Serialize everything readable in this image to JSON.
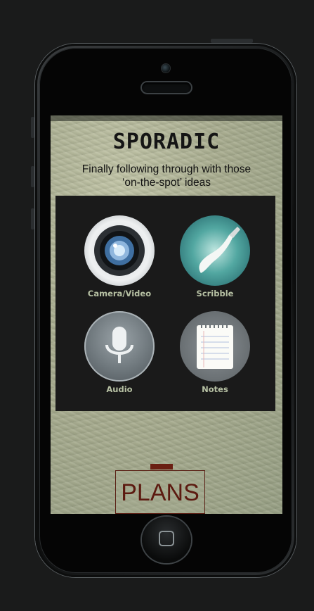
{
  "app": {
    "title": "SPORADIC",
    "tagline_line1": "Finally following through with those",
    "tagline_line2": "‘on-the-spot’ ideas"
  },
  "menu": {
    "items": [
      {
        "label": "Camera/Video",
        "icon": "camera-icon"
      },
      {
        "label": "Scribble",
        "icon": "brush-icon"
      },
      {
        "label": "Audio",
        "icon": "microphone-icon"
      },
      {
        "label": "Notes",
        "icon": "notepad-icon"
      }
    ]
  },
  "footer": {
    "plans_label": "PLANS"
  },
  "colors": {
    "background": "#1a1b1b",
    "panel": "#1a1a1a",
    "label": "#b6c0a3",
    "plans": "#5c1a10"
  }
}
